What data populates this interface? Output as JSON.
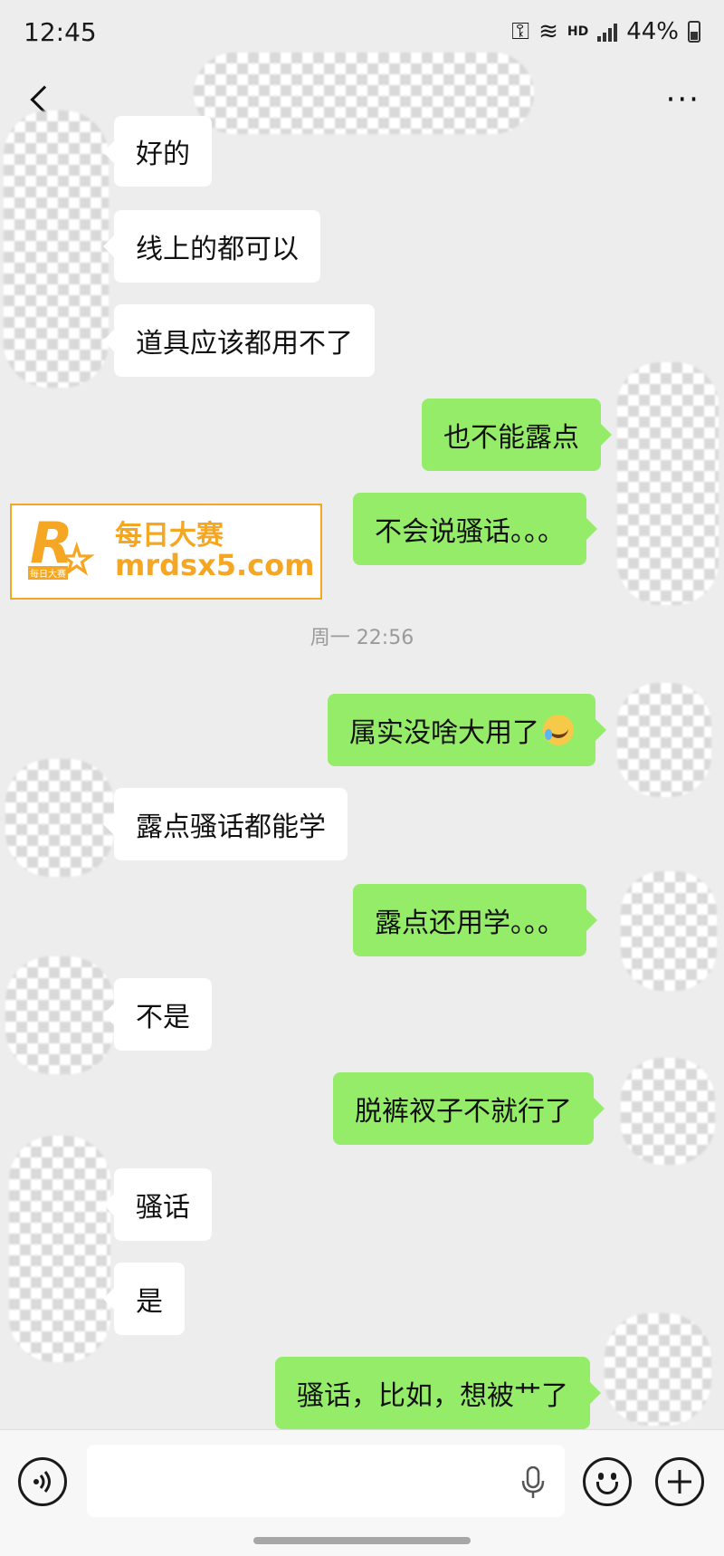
{
  "status_bar": {
    "time": "12:45",
    "battery": "44%",
    "network_badge": "HD"
  },
  "nav": {
    "more_label": "···"
  },
  "watermark": {
    "brand_cn": "每日大赛",
    "domain": "mrdsx5.com",
    "small_text": "每日大赛"
  },
  "conversation": {
    "timestamp": "周一 22:56",
    "messages": [
      {
        "side": "in",
        "text": "好的"
      },
      {
        "side": "in",
        "text": "线上的都可以"
      },
      {
        "side": "in",
        "text": "道具应该都用不了"
      },
      {
        "side": "out",
        "text": "也不能露点"
      },
      {
        "side": "out",
        "text": "不会说骚话。。。"
      },
      {
        "side": "out",
        "text": "属实没啥大用了",
        "emoji": "laughing-crying-emoji"
      },
      {
        "side": "in",
        "text": "露点骚话都能学"
      },
      {
        "side": "out",
        "text": "露点还用学。。。"
      },
      {
        "side": "in",
        "text": "不是"
      },
      {
        "side": "out",
        "text": "脱裤衩子不就行了"
      },
      {
        "side": "in",
        "text": "骚话"
      },
      {
        "side": "in",
        "text": "是"
      },
      {
        "side": "out",
        "text": "骚话，比如，想被艹了"
      }
    ]
  },
  "input_bar": {
    "value": "",
    "placeholder": ""
  },
  "icons": {
    "back": "back-chevron-icon",
    "more": "more-dots-icon",
    "voice": "voice-icon",
    "mic": "mic-icon",
    "emoji": "emoji-icon",
    "plus": "plus-icon"
  },
  "colors": {
    "background": "#ededed",
    "outgoing_bubble": "#95ec69",
    "incoming_bubble": "#ffffff",
    "watermark_accent": "#f5a623"
  }
}
